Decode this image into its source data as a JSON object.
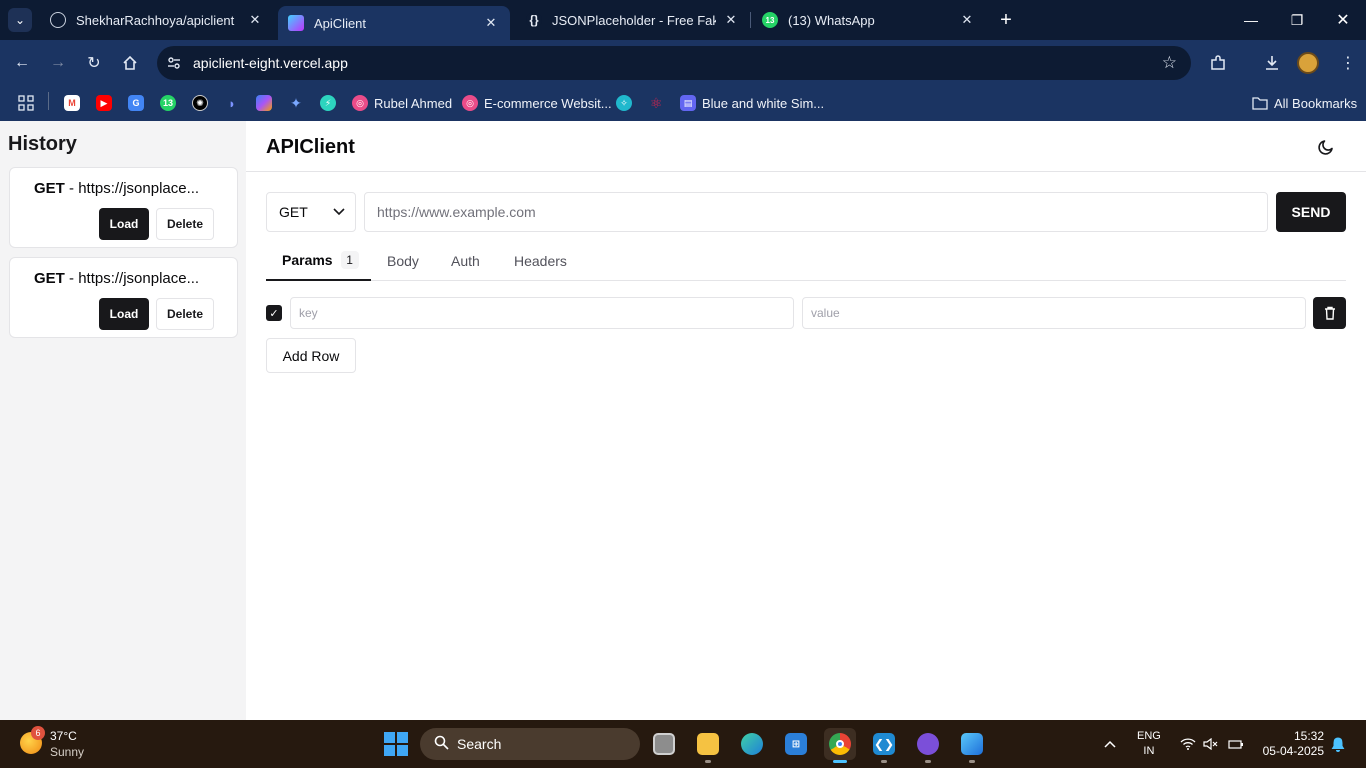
{
  "browser": {
    "tabs": [
      {
        "title": "ShekharRachhoya/apiclient",
        "icon": "github-icon"
      },
      {
        "title": "ApiClient",
        "icon": "vite-icon"
      },
      {
        "title": "JSONPlaceholder - Free Fake RE",
        "icon": "jsonplaceholder-icon"
      },
      {
        "title": "(13) WhatsApp",
        "icon": "whatsapp-icon"
      }
    ],
    "active_tab": 1,
    "url": "apiclient-eight.vercel.app",
    "bookmarks": [
      {
        "label": "",
        "icon": "gmail-icon",
        "color": "#ea4335"
      },
      {
        "label": "",
        "icon": "youtube-icon",
        "color": "#ff0000"
      },
      {
        "label": "",
        "icon": "translate-icon",
        "color": "#4285f4"
      },
      {
        "label": "",
        "icon": "whatsapp-icon",
        "color": "#25d366"
      },
      {
        "label": "",
        "icon": "chatgpt-icon",
        "color": "#000000"
      },
      {
        "label": "",
        "icon": "deepseek-icon",
        "color": "#4d6bfe"
      },
      {
        "label": "",
        "icon": "copilot-icon",
        "color": "#8b5cf6"
      },
      {
        "label": "",
        "icon": "gemini-icon",
        "color": "#4f8ef7"
      },
      {
        "label": "",
        "icon": "bolt-icon",
        "color": "#2dd4bf"
      },
      {
        "label": "Rubel Ahmed",
        "icon": "dribbble-icon",
        "color": "#ea4c89"
      },
      {
        "label": "E-commerce Websit...",
        "icon": "dribbble-icon",
        "color": "#ea4c89"
      },
      {
        "label": "",
        "icon": "perplexity-icon",
        "color": "#20b8cd"
      },
      {
        "label": "",
        "icon": "react-icon",
        "color": "#e0234e"
      },
      {
        "label": "Blue and white Sim...",
        "icon": "canva-print-icon",
        "color": "#6366f1"
      }
    ],
    "all_bookmarks": "All Bookmarks",
    "whatsapp_badge": "13"
  },
  "sidebar": {
    "title": "History",
    "items": [
      {
        "method": "GET",
        "url": "https://jsonplace...",
        "load_label": "Load",
        "delete_label": "Delete"
      },
      {
        "method": "GET",
        "url": "https://jsonplace...",
        "load_label": "Load",
        "delete_label": "Delete"
      }
    ]
  },
  "main": {
    "title": "APIClient",
    "method": "GET",
    "url_placeholder": "https://www.example.com",
    "url_value": "",
    "send_label": "SEND",
    "tabs": [
      {
        "label": "Params",
        "count": "1"
      },
      {
        "label": "Body"
      },
      {
        "label": "Auth"
      },
      {
        "label": "Headers"
      }
    ],
    "active_tab": 0,
    "params": [
      {
        "checked": true,
        "key_placeholder": "key",
        "value_placeholder": "value"
      }
    ],
    "add_row_label": "Add Row"
  },
  "taskbar": {
    "weather_badge": "6",
    "temperature": "37°C",
    "condition": "Sunny",
    "search_label": "Search",
    "lang_top": "ENG",
    "lang_bottom": "IN",
    "time": "15:32",
    "date": "05-04-2025",
    "apps": [
      "task-view-icon",
      "file-explorer-icon",
      "edge-icon",
      "store-icon",
      "chrome-icon",
      "vscode-icon",
      "github-desktop-icon",
      "photos-icon"
    ],
    "active_app": "chrome-icon"
  },
  "colors": {
    "tabstrip": "#0d1b33",
    "toolbar": "#1b3462",
    "primary": "#18181b",
    "sidebar_bg": "#f4f4f5",
    "taskbar": "#26190f"
  }
}
